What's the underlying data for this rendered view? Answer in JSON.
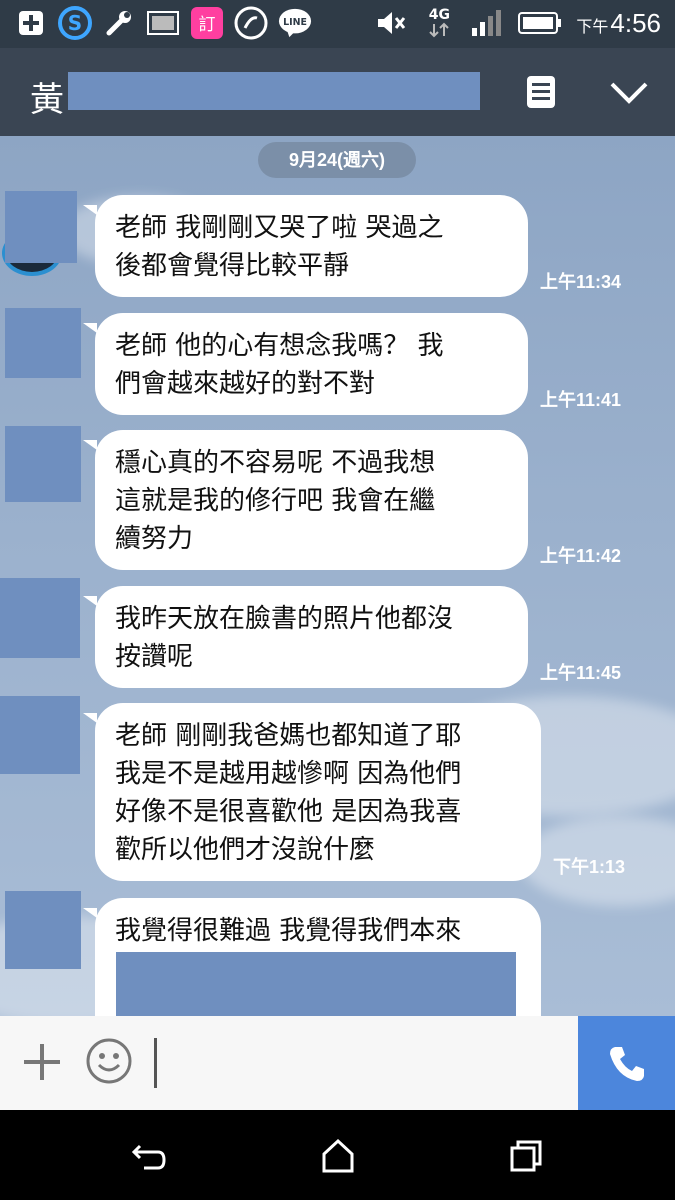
{
  "status_bar": {
    "ampm": "下午",
    "time": "4:56",
    "network": "4G",
    "icons": [
      "plus-icon",
      "s-app-icon",
      "wrench-icon",
      "image-icon",
      "order-app-icon",
      "phone-app-icon",
      "line-icon",
      "mute-icon",
      "signal-icon",
      "battery-icon"
    ],
    "line_badge": "LINE",
    "order_badge": "訂"
  },
  "header": {
    "contact_name": "黃",
    "icons": [
      "notes-icon",
      "chevron-down-icon"
    ]
  },
  "date_divider": "9月24(週六)",
  "messages": [
    {
      "lines": [
        "老師 我剛剛又哭了啦 哭過之",
        "後都會覺得比較平靜"
      ],
      "time": "上午11:34"
    },
    {
      "lines": [
        "老師 他的心有想念我嗎？ 我",
        "們會越來越好的對不對"
      ],
      "time": "上午11:41"
    },
    {
      "lines": [
        "穩心真的不容易呢 不過我想",
        "這就是我的修行吧 我會在繼",
        "續努力"
      ],
      "time": "上午11:42"
    },
    {
      "lines": [
        "我昨天放在臉書的照片他都沒",
        "按讚呢"
      ],
      "time": "上午11:45"
    },
    {
      "lines": [
        "老師 剛剛我爸媽也都知道了耶",
        "我是不是越用越慘啊 因為他們",
        "好像不是很喜歡他 是因為我喜",
        "歡所以他們才沒說什麼"
      ],
      "time": "下午1:13"
    },
    {
      "lines": [
        "我覺得很難過 我覺得我們本來"
      ],
      "time": ""
    }
  ],
  "input": {
    "placeholder": "",
    "value": ""
  },
  "colors": {
    "accent": "#4c86dc",
    "header": "#3a4553",
    "status": "#2f3b47",
    "redaction": "#6f8fbf"
  }
}
